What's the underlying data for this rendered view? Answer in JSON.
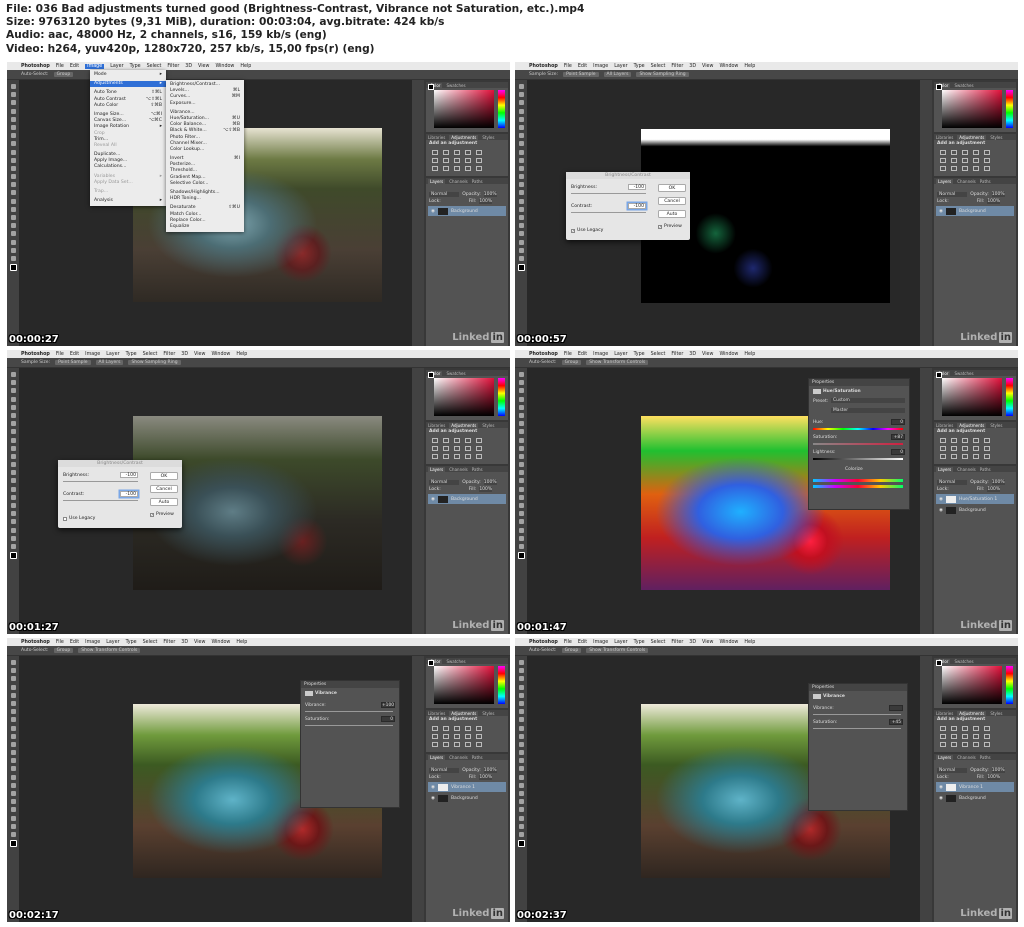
{
  "header": {
    "line1": "File: 036 Bad adjustments turned good (Brightness-Contrast, Vibrance not Saturation, etc.).mp4",
    "line2": "Size: 9763120 bytes (9,31 MiB), duration: 00:03:04, avg.bitrate: 424 kb/s",
    "line3": "Audio: aac, 48000 Hz, 2 channels, s16, 159 kb/s (eng)",
    "line4": "Video: h264, yuv420p, 1280x720, 257 kb/s, 15,00 fps(r) (eng)"
  },
  "menubar": [
    "Photoshop",
    "File",
    "Edit",
    "Image",
    "Layer",
    "Type",
    "Select",
    "Filter",
    "3D",
    "View",
    "Window",
    "Help"
  ],
  "watermark": {
    "text": "Linked",
    "badge": "in"
  },
  "panels": {
    "color_tabs": [
      "Color",
      "Swatches"
    ],
    "adj_tabs": [
      "Libraries",
      "Adjustments",
      "Styles"
    ],
    "add_adjustment": "Add an adjustment",
    "layer_tabs": [
      "Layers",
      "Channels",
      "Paths"
    ],
    "blend": "Normal",
    "opacity_label": "Opacity:",
    "opacity": "100%",
    "lock_label": "Lock:",
    "fill_label": "Fill:",
    "fill": "100%"
  },
  "image_menu": {
    "items": [
      {
        "label": "Mode",
        "sc": "▸"
      },
      {
        "sep": true
      },
      {
        "label": "Adjustments",
        "sc": "▸",
        "hl": true
      },
      {
        "sep": true
      },
      {
        "label": "Auto Tone",
        "sc": "⇧⌘L"
      },
      {
        "label": "Auto Contrast",
        "sc": "⌥⇧⌘L"
      },
      {
        "label": "Auto Color",
        "sc": "⇧⌘B"
      },
      {
        "sep": true
      },
      {
        "label": "Image Size...",
        "sc": "⌥⌘I"
      },
      {
        "label": "Canvas Size...",
        "sc": "⌥⌘C"
      },
      {
        "label": "Image Rotation",
        "sc": "▸"
      },
      {
        "label": "Crop",
        "dis": true
      },
      {
        "label": "Trim..."
      },
      {
        "label": "Reveal All",
        "dis": true
      },
      {
        "sep": true
      },
      {
        "label": "Duplicate..."
      },
      {
        "label": "Apply Image..."
      },
      {
        "label": "Calculations..."
      },
      {
        "sep": true
      },
      {
        "label": "Variables",
        "dis": true,
        "sc": "▸"
      },
      {
        "label": "Apply Data Set...",
        "dis": true
      },
      {
        "sep": true
      },
      {
        "label": "Trap...",
        "dis": true
      },
      {
        "sep": true
      },
      {
        "label": "Analysis",
        "sc": "▸"
      }
    ],
    "submenu": [
      {
        "label": "Brightness/Contrast..."
      },
      {
        "label": "Levels...",
        "sc": "⌘L"
      },
      {
        "label": "Curves...",
        "sc": "⌘M"
      },
      {
        "label": "Exposure..."
      },
      {
        "sep": true
      },
      {
        "label": "Vibrance..."
      },
      {
        "label": "Hue/Saturation...",
        "sc": "⌘U"
      },
      {
        "label": "Color Balance...",
        "sc": "⌘B"
      },
      {
        "label": "Black & White...",
        "sc": "⌥⇧⌘B"
      },
      {
        "label": "Photo Filter..."
      },
      {
        "label": "Channel Mixer..."
      },
      {
        "label": "Color Lookup..."
      },
      {
        "sep": true
      },
      {
        "label": "Invert",
        "sc": "⌘I"
      },
      {
        "label": "Posterize..."
      },
      {
        "label": "Threshold..."
      },
      {
        "label": "Gradient Map..."
      },
      {
        "label": "Selective Color..."
      },
      {
        "sep": true
      },
      {
        "label": "Shadows/Highlights..."
      },
      {
        "label": "HDR Toning..."
      },
      {
        "sep": true
      },
      {
        "label": "Desaturate",
        "sc": "⇧⌘U"
      },
      {
        "label": "Match Color..."
      },
      {
        "label": "Replace Color..."
      },
      {
        "label": "Equalize"
      }
    ]
  },
  "frames": [
    {
      "time": "00:00:27",
      "options": [
        "Auto-Select:",
        "Group"
      ],
      "image": "normal",
      "overlay": "menu",
      "layers": [
        {
          "name": "Background"
        }
      ]
    },
    {
      "time": "00:00:57",
      "options": [
        "Sample Size:",
        "Point Sample",
        "All Layers",
        "Show Sampling Ring"
      ],
      "image": "black",
      "overlay": "dialog",
      "dialog": {
        "title": "Brightness/Contrast",
        "brightness_label": "Brightness:",
        "brightness": "-100",
        "contrast_label": "Contrast:",
        "contrast": "-100",
        "ok": "OK",
        "cancel": "Cancel",
        "auto": "Auto",
        "legacy": "Use Legacy",
        "legacy_checked": true,
        "preview": "Preview",
        "preview_checked": true
      },
      "layers": [
        {
          "name": "Background"
        }
      ]
    },
    {
      "time": "00:01:27",
      "options": [
        "Sample Size:",
        "Point Sample",
        "All Layers",
        "Show Sampling Ring"
      ],
      "image": "dark",
      "overlay": "dialog",
      "dialog": {
        "title": "Brightness/Contrast",
        "brightness_label": "Brightness:",
        "brightness": "-100",
        "contrast_label": "Contrast:",
        "contrast": "-100",
        "ok": "OK",
        "cancel": "Cancel",
        "auto": "Auto",
        "legacy": "Use Legacy",
        "legacy_checked": false,
        "preview": "Preview",
        "preview_checked": true
      },
      "layers": [
        {
          "name": "Background"
        }
      ]
    },
    {
      "time": "00:01:47",
      "options": [
        "Auto-Select:",
        "Group",
        "Show Transform Controls"
      ],
      "image": "saturated",
      "overlay": "hue",
      "props": {
        "title": "Properties",
        "name": "Hue/Saturation",
        "preset_label": "Preset:",
        "preset": "Custom",
        "channel": "Master",
        "hue_label": "Hue:",
        "hue": "0",
        "sat_label": "Saturation:",
        "sat": "+87",
        "light_label": "Lightness:",
        "light": "0",
        "colorize": "Colorize"
      },
      "layers": [
        {
          "name": "Hue/Saturation 1",
          "adj": true
        },
        {
          "name": "Background"
        }
      ]
    },
    {
      "time": "00:02:17",
      "options": [
        "Auto-Select:",
        "Group",
        "Show Transform Controls"
      ],
      "image": "vivid",
      "overlay": "vibrance",
      "props": {
        "title": "Properties",
        "name": "Vibrance",
        "vib_label": "Vibrance:",
        "vib": "+100",
        "sat_label": "Saturation:",
        "sat": "0"
      },
      "layers": [
        {
          "name": "Vibrance 1",
          "adj": true
        },
        {
          "name": "Background"
        }
      ]
    },
    {
      "time": "00:02:37",
      "options": [
        "Auto-Select:",
        "Group",
        "Show Transform Controls"
      ],
      "image": "vivid",
      "overlay": "vibrance",
      "props": {
        "title": "Properties",
        "name": "Vibrance",
        "vib_label": "Vibrance:",
        "vib": "",
        "sat_label": "Saturation:",
        "sat": "+45"
      },
      "layers": [
        {
          "name": "Vibrance 1",
          "adj": true
        },
        {
          "name": "Background"
        }
      ]
    }
  ]
}
